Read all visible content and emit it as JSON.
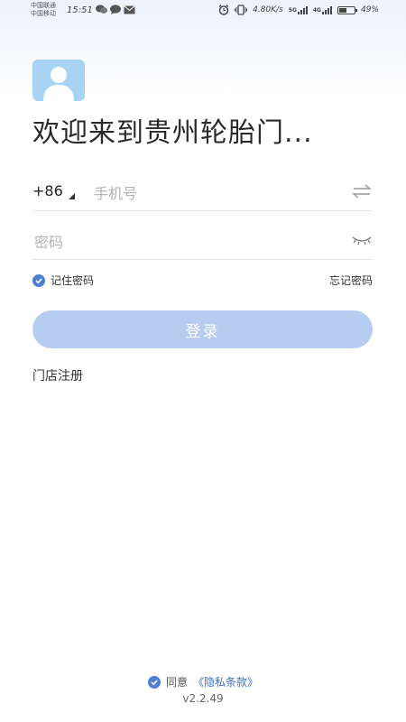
{
  "status_bar": {
    "carrier1": "中国联通",
    "carrier2": "中国移动",
    "time": "15:51",
    "net_speed": "4.80K/s",
    "sig1_tag": "5G",
    "sig2_tag": "4G",
    "battery": "49%",
    "battery_level": 0.49,
    "icons": [
      "wechat-icon",
      "chat-bubble-icon",
      "mail-icon",
      "alarm-icon",
      "vibrate-icon",
      "signal-icon",
      "battery-icon"
    ]
  },
  "header": {
    "avatar_icon": "user-avatar-icon",
    "title": "欢迎来到贵州轮胎门..."
  },
  "phone": {
    "country_code": "+86",
    "placeholder": "手机号",
    "switch_icon": "swap-arrows-icon"
  },
  "password": {
    "placeholder": "密码",
    "toggle_icon": "eye-closed-icon"
  },
  "remember_label": "记住密码",
  "forgot_label": "忘记密码",
  "login_label": "登录",
  "register_label": "门店注册",
  "agreement": {
    "prefix": "同意",
    "link": "《隐私条款》"
  },
  "version": "v2.2.49",
  "colors": {
    "accent": "#4f7fd0",
    "button_bg": "#b6cdf1",
    "avatar_bg": "#a9d3f2",
    "link": "#3d6dc4"
  }
}
